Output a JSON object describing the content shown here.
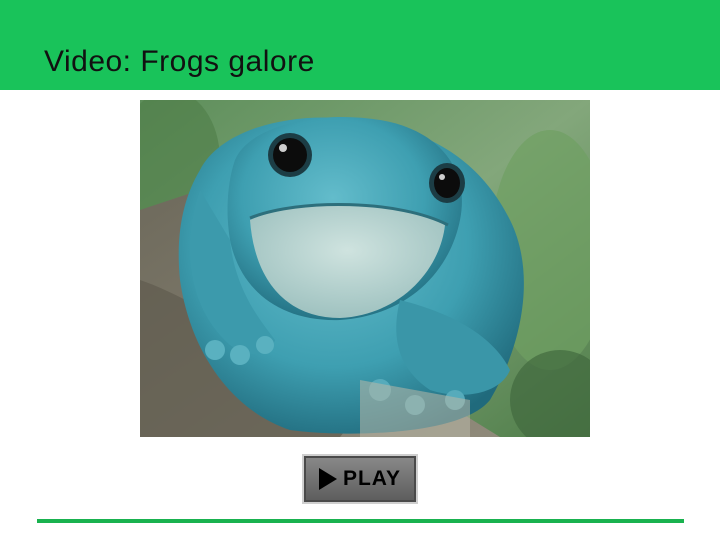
{
  "slide": {
    "title": "Video: Frogs galore"
  },
  "video": {
    "subject": "frog-image",
    "play_label": "PLAY",
    "play_icon": "play-triangle-icon"
  },
  "colors": {
    "header": "#19c35a",
    "footer_line": "#19b24f",
    "frog_body": "#3a9cae"
  }
}
